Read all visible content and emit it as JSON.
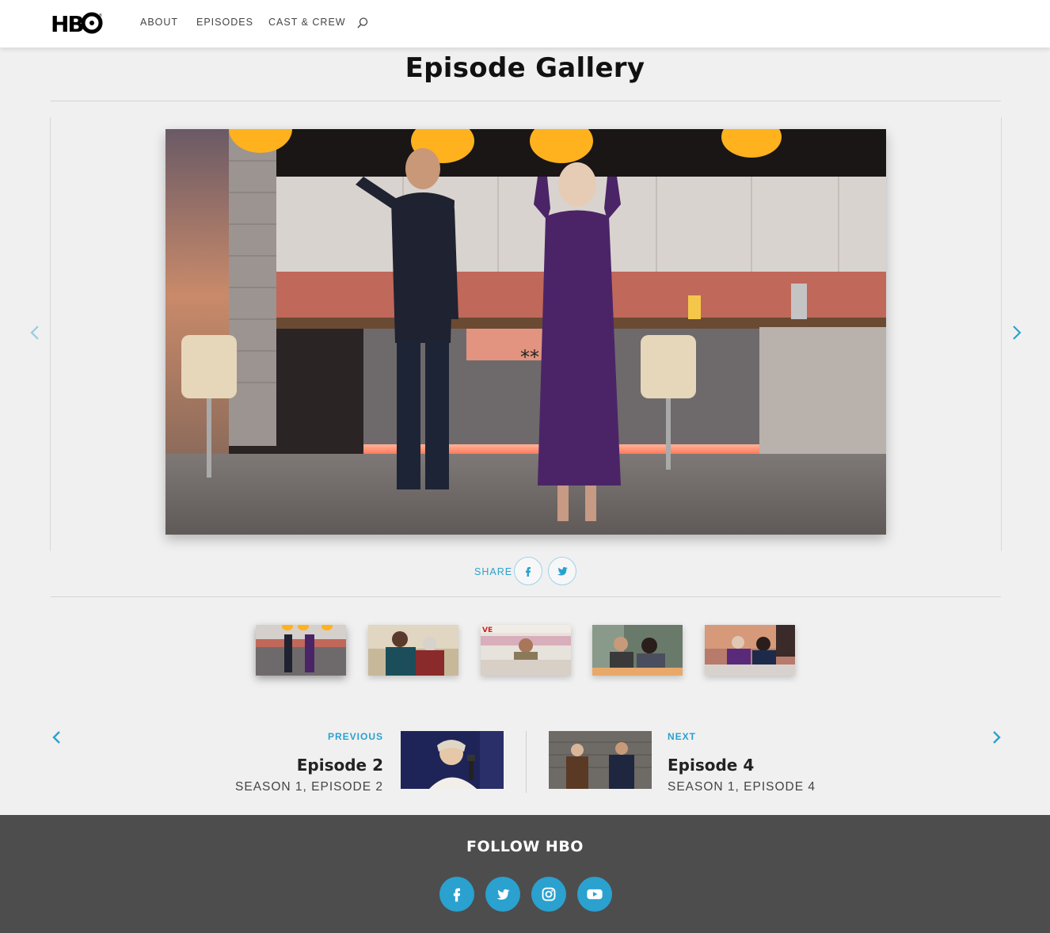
{
  "header": {
    "logo_text": "HBO",
    "nav": [
      {
        "label": "ABOUT"
      },
      {
        "label": "EPISODES"
      },
      {
        "label": "CAST & CREW"
      }
    ],
    "search_icon": "search-icon"
  },
  "page": {
    "title": "Episode Gallery"
  },
  "gallery": {
    "prev_icon": "chevron-left-icon",
    "next_icon": "chevron-right-icon",
    "share_label": "SHARE",
    "share_buttons": [
      "facebook-icon",
      "twitter-icon"
    ],
    "thumbnail_count": 5,
    "selected_thumbnail": 1
  },
  "pagination": {
    "previous": {
      "kicker": "PREVIOUS",
      "title": "Episode 2",
      "subtitle": "SEASON 1, EPISODE 2"
    },
    "next": {
      "kicker": "NEXT",
      "title": "Episode 4",
      "subtitle": "SEASON 1, EPISODE 4"
    }
  },
  "footer": {
    "title": "FOLLOW HBO",
    "social": [
      "facebook-icon",
      "twitter-icon",
      "instagram-icon",
      "youtube-icon"
    ]
  },
  "colors": {
    "accent": "#2aa1cf",
    "footer_bg": "#4d4d4d",
    "page_bg": "#f0f0f0"
  }
}
